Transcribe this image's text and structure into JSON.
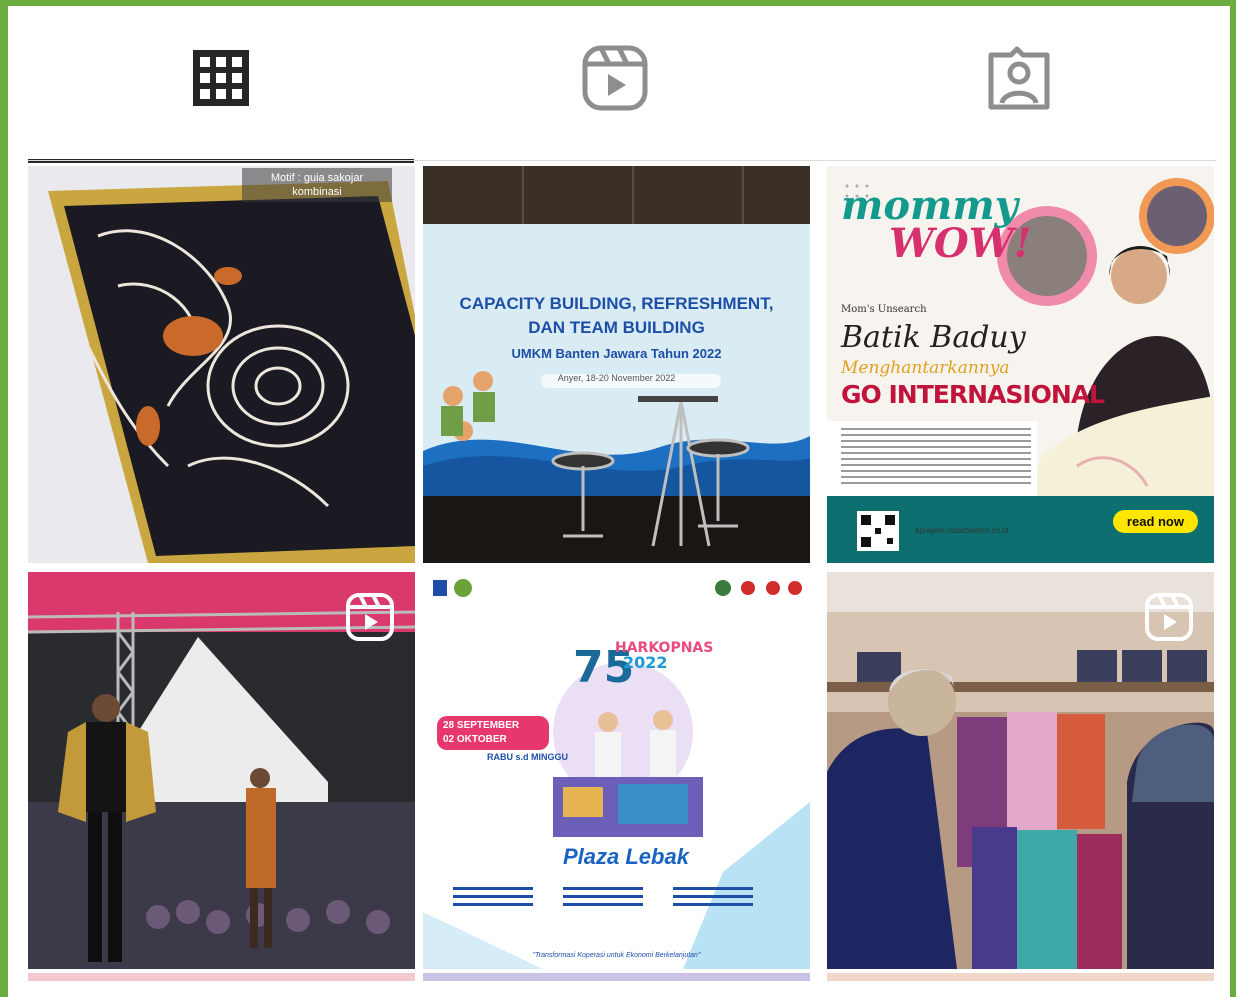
{
  "profile_tabs": [
    {
      "label": "Posts",
      "icon": "grid-icon",
      "active": true
    },
    {
      "label": "Reels",
      "icon": "reels-icon",
      "active": false
    },
    {
      "label": "Tagged",
      "icon": "tagged-person-icon",
      "active": false
    }
  ],
  "posts": [
    {
      "type": "image",
      "caption_tag": [
        "Motif : guia sakojar",
        "kombinasi"
      ]
    },
    {
      "type": "image",
      "banner_lines": [
        "CAPACITY BUILDING, REFRESHMENT,",
        "DAN TEAM BUILDING",
        "UMKM Banten Jawara Tahun 2022",
        "Anyer, 18-20 November 2022"
      ]
    },
    {
      "type": "image",
      "title_a": "mommy",
      "title_b": "WOW!",
      "subtitle": "Mom's Unsearch",
      "headline": "Batik Baduy",
      "kicker": "Menghantarkannya",
      "headline2": "GO INTERNASIONAL",
      "website": "aprajeer.radarbanten.co.id",
      "cta": "read now"
    },
    {
      "type": "reel",
      "badge_icon": "reel-icon"
    },
    {
      "type": "image",
      "date_start": "28 SEPTEMBER",
      "date_end": "02 OKTOBER",
      "year": "2022",
      "days": "RABU s.d MINGGU",
      "venue": "Plaza Lebak",
      "tagline": "\"Transformasi Koperasi untuk Ekonomi Berkelanjutan\""
    },
    {
      "type": "reel",
      "badge_icon": "reel-icon"
    }
  ],
  "colors": {
    "frame": "#6aac3f",
    "tab_active": "#262626",
    "tab_inactive": "#8e8e8e",
    "divider": "#dbdbdb"
  }
}
